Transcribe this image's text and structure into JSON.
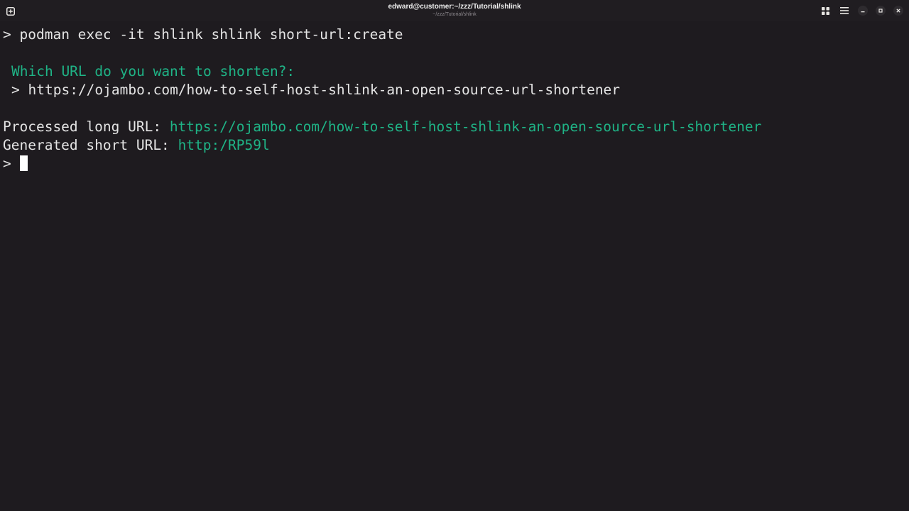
{
  "window": {
    "title": "edward@customer:~/zzz/Tutorial/shlink",
    "subtitle": "~/zzz/Tutorial/shlink"
  },
  "titlebar_icons": {
    "new_tab": "new-tab-icon",
    "grid": "grid-icon",
    "menu": "hamburger-menu-icon",
    "minimize": "minimize-icon",
    "maximize": "maximize-icon",
    "close": "close-icon"
  },
  "terminal": {
    "prompt_symbol": ">",
    "command": "podman exec -it shlink shlink short-url:create",
    "question": "Which URL do you want to shorten?:",
    "answer_prompt": ">",
    "answer": "https://ojambo.com/how-to-self-host-shlink-an-open-source-url-shortener",
    "processed_label": "Processed long URL:",
    "processed_value": "https://ojambo.com/how-to-self-host-shlink-an-open-source-url-shortener",
    "generated_label": "Generated short URL:",
    "generated_value": "http:/RP59l",
    "final_prompt": ">"
  },
  "colors": {
    "background": "#1e1b1f",
    "titlebar": "#201d21",
    "foreground": "#e4e4e4",
    "accent_green": "#1fb386"
  }
}
